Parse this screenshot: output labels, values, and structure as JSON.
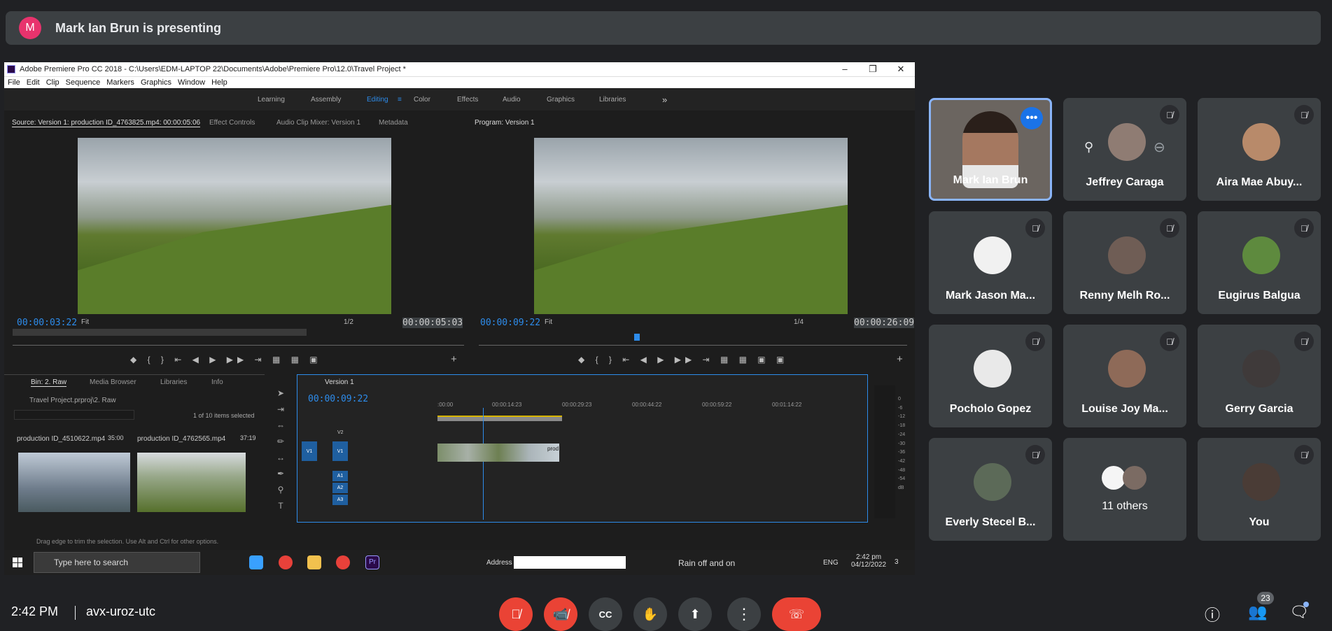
{
  "banner": {
    "avatar_letter": "M",
    "text": "Mark Ian Brun is presenting"
  },
  "premiere": {
    "title": "Adobe Premiere Pro CC 2018 - C:\\Users\\EDM-LAPTOP 22\\Documents\\Adobe\\Premiere Pro\\12.0\\Travel Project *",
    "menu": [
      "File",
      "Edit",
      "Clip",
      "Sequence",
      "Markers",
      "Graphics",
      "Window",
      "Help"
    ],
    "workspaces": [
      "Learning",
      "Assembly",
      "Editing",
      "Color",
      "Effects",
      "Audio",
      "Graphics",
      "Libraries"
    ],
    "overflow": "»",
    "source_tabs": [
      "Source: Version 1: production ID_4763825.mp4: 00:00:05:06",
      "Effect Controls",
      "Audio Clip Mixer: Version 1",
      "Metadata"
    ],
    "program_tab": "Program: Version 1",
    "source_tc_current": "00:00:03:22",
    "source_tc_duration": "00:00:05:03",
    "source_fit": "Fit",
    "source_res": "1/2",
    "program_tc_current": "00:00:09:22",
    "program_tc_duration": "00:00:26:09",
    "program_fit": "Fit",
    "program_res": "1/4",
    "project_tabs": [
      "Bin: 2. Raw",
      "Media Browser",
      "Libraries",
      "Info"
    ],
    "project_path": "Travel Project.prproj\\2. Raw",
    "items_selected": "1 of 10 items selected",
    "clip1_name": "production ID_4510622.mp4",
    "clip1_dur": "35:00",
    "clip2_name": "production ID_4762565.mp4",
    "clip2_dur": "37:19",
    "seq_tab": "Version 1",
    "seq_tc": "00:00:09:22",
    "ruler": [
      ":00:00",
      "00:00:14:23",
      "00:00:29:23",
      "00:00:44:22",
      "00:00:59:22",
      "00:01:14:22"
    ],
    "tracks": [
      "V2",
      "V1",
      "A1",
      "A2",
      "A3"
    ],
    "clip_label": "prod",
    "meter_ticks": [
      "0",
      "-6",
      "-12",
      "-18",
      "-24",
      "-30",
      "-36",
      "-42",
      "-48",
      "-54",
      "dB"
    ],
    "status": "Drag edge to trim the selection. Use Alt and Ctrl for other options.",
    "taskbar": {
      "search": "Type here to search",
      "address": "Address",
      "weather": "Rain off and on",
      "lang": "ENG",
      "time": "2:42 pm",
      "date": "04/12/2022",
      "notif_count": "3"
    }
  },
  "participants": [
    {
      "name": "Mark Ian Brun"
    },
    {
      "name": "Jeffrey Caraga"
    },
    {
      "name": "Aira Mae Abuy..."
    },
    {
      "name": "Mark Jason Ma..."
    },
    {
      "name": "Renny Melh Ro..."
    },
    {
      "name": "Eugirus Balgua"
    },
    {
      "name": "Pocholo Gopez"
    },
    {
      "name": "Louise Joy Ma..."
    },
    {
      "name": "Gerry Garcia"
    },
    {
      "name": "Everly Stecel B..."
    },
    {
      "name": "11 others"
    },
    {
      "name": "You"
    }
  ],
  "bottom": {
    "time": "2:42 PM",
    "meeting_code": "avx-uroz-utc",
    "people_count": "23"
  },
  "colors": {
    "accent": "#8ab4f8",
    "end_call": "#ea4335",
    "premiere_blue": "#2d8ceb"
  }
}
